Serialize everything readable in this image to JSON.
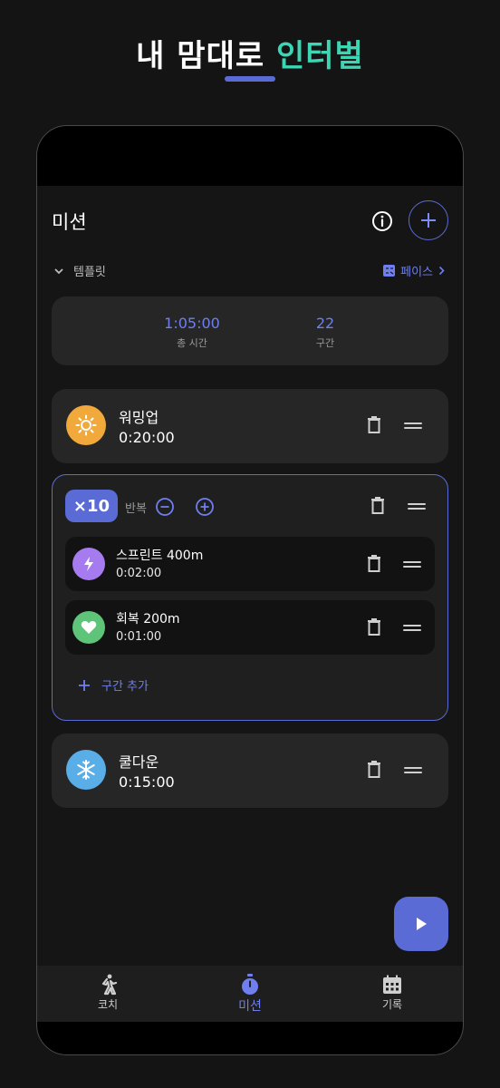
{
  "promo": {
    "title_main": "내 맘대로",
    "title_accent": "인터벌"
  },
  "header": {
    "title": "미션"
  },
  "template": {
    "label": "템플릿",
    "pace_label": "페이스"
  },
  "summary": {
    "total_time_value": "1:05:00",
    "total_time_label": "총 시간",
    "segments_value": "22",
    "segments_label": "구간"
  },
  "warmup": {
    "name": "워밍업",
    "time": "0:20:00",
    "icon": "sun-icon",
    "color": "#f0a93a"
  },
  "repeat": {
    "badge": "×10",
    "label": "반복",
    "items": [
      {
        "name": "스프린트 400m",
        "time": "0:02:00",
        "icon": "lightning-icon",
        "color": "#a77bf0"
      },
      {
        "name": "회복 200m",
        "time": "0:01:00",
        "icon": "heart-icon",
        "color": "#5ec47a"
      }
    ],
    "add_label": "구간 추가"
  },
  "cooldown": {
    "name": "쿨다운",
    "time": "0:15:00",
    "icon": "snowflake-icon",
    "color": "#5aaee8"
  },
  "tabs": [
    {
      "label": "코치",
      "icon": "runner-icon",
      "active": false
    },
    {
      "label": "미션",
      "icon": "stopwatch-icon",
      "active": true
    },
    {
      "label": "기록",
      "icon": "calendar-icon",
      "active": false
    }
  ],
  "colors": {
    "accent": "#5b6bd5",
    "accent_text": "#6f7ff0",
    "promo_accent": "#3dd6b5"
  }
}
